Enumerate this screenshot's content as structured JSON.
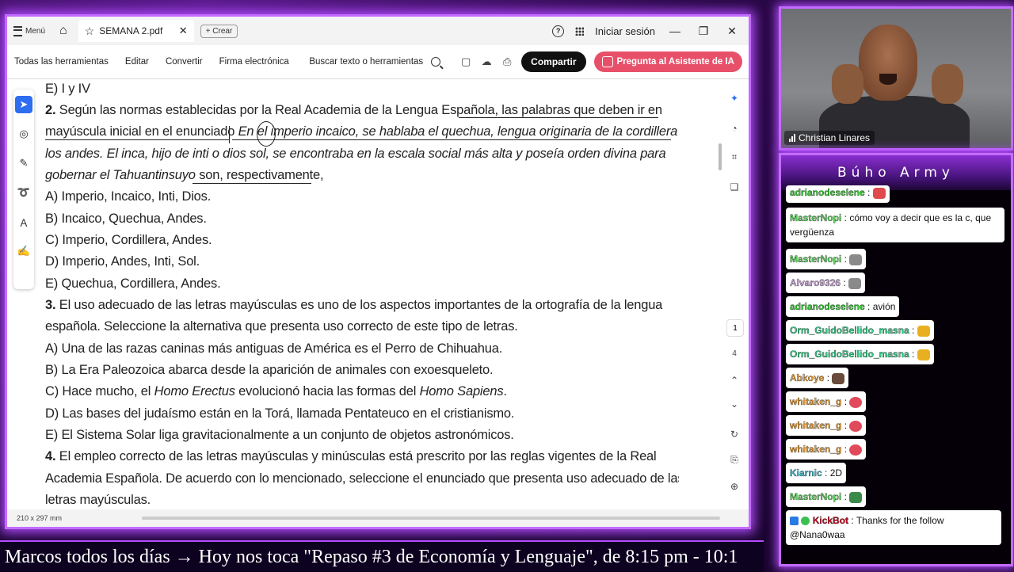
{
  "titlebar": {
    "menu_label": "Menú",
    "tab_title": "SEMANA 2.pdf",
    "new_tab_label": "+ Crear",
    "signin_label": "Iniciar sesión"
  },
  "toolbar": {
    "tools": [
      "Todas las herramientas",
      "Editar",
      "Convertir",
      "Firma electrónica"
    ],
    "search_label": "Buscar texto o herramientas",
    "share_label": "Compartir",
    "ai_label": "Pregunta al Asistente de IA"
  },
  "document": {
    "lines": [
      "E) I y IV",
      "Según las normas establecidas por la Real Academia de la Lengua Española, las palabras que deben ir en",
      "mayúscula inicial en el enunciado",
      "En el imperio incaico, se hablaba el quechua, lengua originaria de la cordillera de",
      "los andes. El inca, hijo de inti o dios sol, se encontraba en la escala social más alta y poseía orden divina para",
      "gobernar el Tahuantinsuyo",
      "son, respectivamente,",
      "A) Imperio, Incaico, Inti, Dios.",
      "B) Incaico, Quechua, Andes.",
      "C) Imperio, Cordillera, Andes.",
      "D) Imperio, Andes, Inti, Sol.",
      "E) Quechua, Cordillera, Andes.",
      "El uso adecuado de las letras mayúsculas es uno de los aspectos importantes de la ortografía de la lengua",
      "española. Seleccione la alternativa que presenta uso correcto de este tipo de letras.",
      "A) Una de las razas caninas más antiguas de América es el Perro de Chihuahua.",
      "B) La Era Paleozoica abarca desde la aparición de animales con exoesqueleto.",
      "C) Hace mucho, el",
      "Homo Erectus",
      "evolucionó hacia las formas del",
      "Homo Sapiens",
      "D) Las bases del judaísmo están en la Torá, llamada Pentateuco en el cristianismo.",
      "E) El Sistema Solar liga gravitacionalmente a un conjunto de objetos astronómicos.",
      "El empleo correcto de las letras mayúsculas y minúsculas está prescrito por las reglas vigentes de la Real",
      "Academia Española. De acuerdo con lo mencionado, seleccione el enunciado que presenta uso adecuado de las",
      "letras mayúsculas."
    ],
    "q2_num": "2.",
    "q3_num": "3.",
    "q4_num": "4.",
    "period": "."
  },
  "pager": {
    "current": "1",
    "total": "4"
  },
  "status": {
    "page_size": "210 x 297 mm"
  },
  "webcam": {
    "name": "Christian Linares"
  },
  "chat": {
    "title": "Búho Army",
    "messages": [
      {
        "user": "adrianodeselene",
        "text": "",
        "color": "#2fd02f"
      },
      {
        "user": "MasterNopi",
        "text": "cómo voy a decir que es la c, que vergüenza",
        "color": "#5fd05f"
      },
      {
        "user": "MasterNopi",
        "text": "",
        "color": "#5fd05f"
      },
      {
        "user": "Alvaro9326",
        "text": "",
        "color": "#c9a0d8"
      },
      {
        "user": "adrianodeselene",
        "text": "avión",
        "color": "#2fd02f"
      },
      {
        "user": "Orm_GuidoBellido_masna",
        "text": "",
        "color": "#35d08a"
      },
      {
        "user": "Orm_GuidoBellido_masna",
        "text": "",
        "color": "#35d08a"
      },
      {
        "user": "Abkoye",
        "text": "",
        "color": "#e7a040"
      },
      {
        "user": "whitaken_g",
        "text": "",
        "color": "#e7a040"
      },
      {
        "user": "whitaken_g",
        "text": "",
        "color": "#e7a040"
      },
      {
        "user": "whitaken_g",
        "text": "",
        "color": "#e7a040"
      },
      {
        "user": "Kiarnic",
        "text": "2D",
        "color": "#35b8d0"
      },
      {
        "user": "MasterNopi",
        "text": "",
        "color": "#5fd05f"
      },
      {
        "user": "KickBot",
        "text": "Thanks for the follow @Nana0waa",
        "color": "#d0102a"
      }
    ]
  },
  "ticker": {
    "text": "Marcos todos los días  →  Hoy nos toca \"Repaso #3 de Economía y Lenguaje\", de 8:15 pm - 10:1"
  },
  "colors": {
    "accent_glow": "#c46bff",
    "share_bg": "#111111",
    "ai_bg": "#e8506a",
    "active_tool": "#2d6df0"
  }
}
